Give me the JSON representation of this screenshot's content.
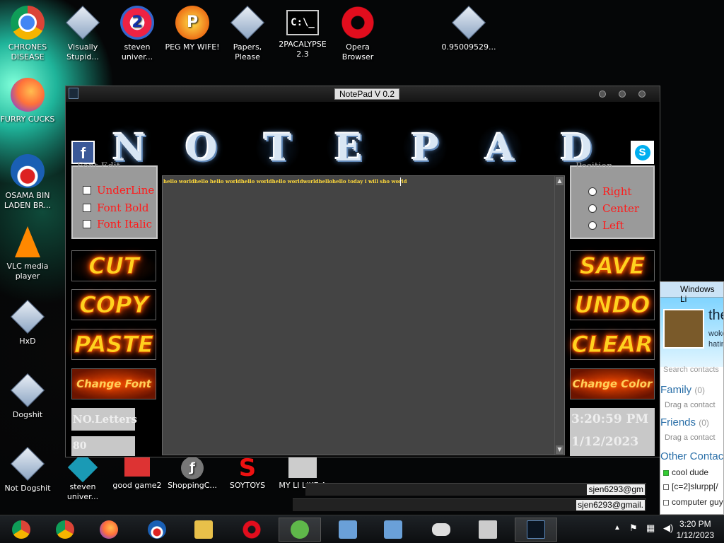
{
  "desktop_icons": [
    {
      "label": "CHRONES DISEASE",
      "icon": "chrome-icon"
    },
    {
      "label": "Visually Stupid...",
      "icon": "file-icon"
    },
    {
      "label": "steven univer...",
      "icon": "steven-icon"
    },
    {
      "label": "PEG MY WIFE!",
      "icon": "peg-icon"
    },
    {
      "label": "Papers, Please",
      "icon": "file-icon"
    },
    {
      "label": "2PACALYPSE 2.3",
      "icon": "cmd-icon"
    },
    {
      "label": "Opera Browser",
      "icon": "opera-icon"
    },
    {
      "label": "0.95009529...",
      "icon": "file-icon"
    },
    {
      "label": "FURRY CUCKS",
      "icon": "firefox-icon"
    },
    {
      "label": "OSAMA BIN LADEN BR...",
      "icon": "obama-icon"
    },
    {
      "label": "VLC media player",
      "icon": "vlc-icon"
    },
    {
      "label": "HxD",
      "icon": "file-icon"
    },
    {
      "label": "Dogshit",
      "icon": "file-icon"
    },
    {
      "label": "Not Dogshit",
      "icon": "file-icon"
    },
    {
      "label": "steven univer...",
      "icon": "steven-icon"
    },
    {
      "label": "good game2",
      "icon": "game-icon"
    },
    {
      "label": "ShoppingC...",
      "icon": "flash-icon"
    },
    {
      "label": "SOYTOYS",
      "icon": "soy-icon"
    },
    {
      "label": "MY LI LIKE A",
      "icon": "file-icon"
    }
  ],
  "app": {
    "title": "NotePad V 0.2",
    "banner_letters": [
      "N",
      "O",
      "T",
      "E",
      "P",
      "A",
      "D"
    ],
    "facebook": "f",
    "skype": "S",
    "font_edit": {
      "title": "Font Edit",
      "options": [
        "UnderLine",
        "Font Bold",
        "Font Italic"
      ]
    },
    "position": {
      "title": "Position",
      "options": [
        "Right",
        "Center",
        "Left"
      ],
      "selected": ""
    },
    "buttons_left": [
      "CUT",
      "COPY",
      "PASTE",
      "Change Font"
    ],
    "buttons_right": [
      "SAVE",
      "UNDO",
      "CLEAR",
      "Change Color"
    ],
    "letters_label": "NO.Letters",
    "letters_value": "80",
    "time": "3:20:59 PM",
    "date": "1/12/2023",
    "text": "hello worldhello hello worldhello worldhello worldworldhellohello today i will sho world"
  },
  "live": {
    "title": "Windows Li",
    "name": "the",
    "status": "woke hatin",
    "search_placeholder": "Search contacts",
    "groups": [
      {
        "name": "Family",
        "count": "(0)",
        "hint": "Drag a contact"
      },
      {
        "name": "Friends",
        "count": "(0)",
        "hint": "Drag a contact"
      }
    ],
    "other": "Other Contac",
    "contacts": [
      "cool dude",
      "[c=2]slurpp[/",
      "computer guy"
    ]
  },
  "strips": [
    "sjen6293@gm",
    "sjen6293@gmail."
  ],
  "taskbar": {
    "time": "3:20 PM",
    "date": "1/12/2023"
  },
  "colors": {
    "accent_red": "#ff1a1a",
    "text_yellow": "#ffd93a",
    "live_blue": "#2a6fa8"
  }
}
